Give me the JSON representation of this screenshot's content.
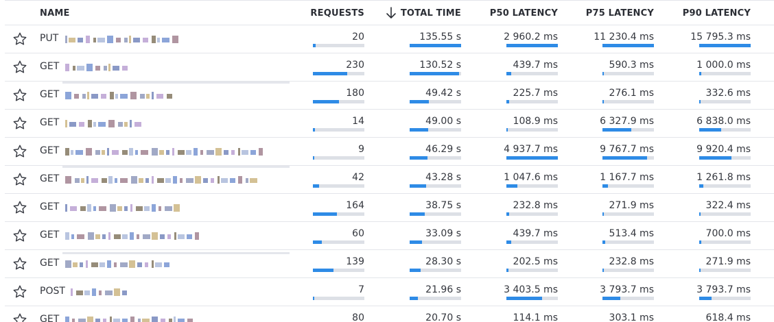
{
  "columns": {
    "name": "NAME",
    "requests": "REQUESTS",
    "total_time": "TOTAL TIME",
    "p50": "P50 LATENCY",
    "p75": "P75 LATENCY",
    "p90": "P90 LATENCY"
  },
  "sort": {
    "column": "total_time",
    "direction": "descending",
    "icon": "arrow-down-icon"
  },
  "row_icon": "star-outline-icon",
  "accent_color": "#2e8be6",
  "track_color": "#dde0e6",
  "rows": [
    {
      "method": "PUT",
      "requests": "20",
      "requests_fill": 0.05,
      "total_time": "135.55 s",
      "total_fill": 1.0,
      "p50": "2 960.2 ms",
      "p50_fill": 1.0,
      "p75": "11 230.4 ms",
      "p75_fill": 1.0,
      "p90": "15 795.3 ms",
      "p90_fill": 1.0
    },
    {
      "method": "GET",
      "requests": "230",
      "requests_fill": 0.66,
      "total_time": "130.52 s",
      "total_fill": 0.96,
      "p50": "439.7 ms",
      "p50_fill": 0.09,
      "p75": "590.3 ms",
      "p75_fill": 0.03,
      "p90": "1 000.0 ms",
      "p90_fill": 0.04
    },
    {
      "method": "GET",
      "requests": "180",
      "requests_fill": 0.51,
      "total_time": "49.42 s",
      "total_fill": 0.37,
      "p50": "225.7 ms",
      "p50_fill": 0.05,
      "p75": "276.1 ms",
      "p75_fill": 0.02,
      "p90": "332.6 ms",
      "p90_fill": 0.02
    },
    {
      "method": "GET",
      "requests": "14",
      "requests_fill": 0.04,
      "total_time": "49.00 s",
      "total_fill": 0.36,
      "p50": "108.9 ms",
      "p50_fill": 0.02,
      "p75": "6 327.9 ms",
      "p75_fill": 0.56,
      "p90": "6 838.0 ms",
      "p90_fill": 0.43
    },
    {
      "method": "GET",
      "requests": "9",
      "requests_fill": 0.03,
      "total_time": "46.29 s",
      "total_fill": 0.34,
      "p50": "4 937.7 ms",
      "p50_fill": 1.0,
      "p75": "9 767.7 ms",
      "p75_fill": 0.87,
      "p90": "9 920.4 ms",
      "p90_fill": 0.63
    },
    {
      "method": "GET",
      "requests": "42",
      "requests_fill": 0.12,
      "total_time": "43.28 s",
      "total_fill": 0.32,
      "p50": "1 047.6 ms",
      "p50_fill": 0.21,
      "p75": "1 167.7 ms",
      "p75_fill": 0.1,
      "p90": "1 261.8 ms",
      "p90_fill": 0.08
    },
    {
      "method": "GET",
      "requests": "164",
      "requests_fill": 0.47,
      "total_time": "38.75 s",
      "total_fill": 0.29,
      "p50": "232.8 ms",
      "p50_fill": 0.05,
      "p75": "271.9 ms",
      "p75_fill": 0.02,
      "p90": "322.4 ms",
      "p90_fill": 0.02
    },
    {
      "method": "GET",
      "requests": "60",
      "requests_fill": 0.17,
      "total_time": "33.09 s",
      "total_fill": 0.24,
      "p50": "439.7 ms",
      "p50_fill": 0.09,
      "p75": "513.4 ms",
      "p75_fill": 0.05,
      "p90": "700.0 ms",
      "p90_fill": 0.04
    },
    {
      "method": "GET",
      "requests": "139",
      "requests_fill": 0.4,
      "total_time": "28.30 s",
      "total_fill": 0.21,
      "p50": "202.5 ms",
      "p50_fill": 0.04,
      "p75": "232.8 ms",
      "p75_fill": 0.02,
      "p90": "271.9 ms",
      "p90_fill": 0.02
    },
    {
      "method": "POST",
      "requests": "7",
      "requests_fill": 0.02,
      "total_time": "21.96 s",
      "total_fill": 0.16,
      "p50": "3 403.5 ms",
      "p50_fill": 0.69,
      "p75": "3 793.7 ms",
      "p75_fill": 0.34,
      "p90": "3 793.7 ms",
      "p90_fill": 0.24
    },
    {
      "method": "GET",
      "requests": "80",
      "requests_fill": 0.23,
      "total_time": "20.70 s",
      "total_fill": 0.15,
      "p50": "114.1 ms",
      "p50_fill": 0.02,
      "p75": "303.1 ms",
      "p75_fill": 0.03,
      "p90": "618.4 ms",
      "p90_fill": 0.04
    }
  ]
}
